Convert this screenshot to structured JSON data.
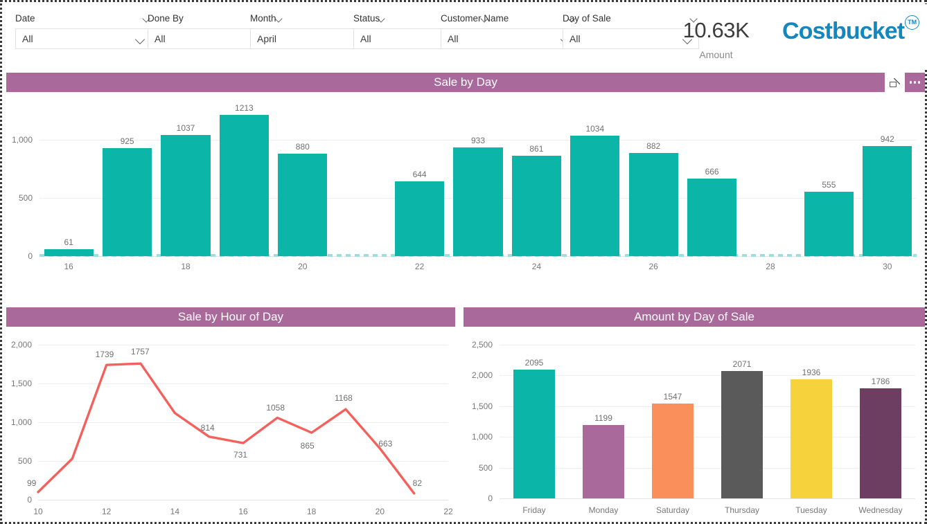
{
  "header": {
    "slicers": [
      {
        "label": "Date",
        "value": "All"
      },
      {
        "label": "Done By",
        "value": "All"
      },
      {
        "label": "Month",
        "value": "April"
      },
      {
        "label": "Status",
        "value": "All"
      },
      {
        "label": "Customer Name",
        "value": "All"
      },
      {
        "label": "Day of Sale",
        "value": "All"
      }
    ],
    "kpi": {
      "value": "10.63K",
      "label": "Amount"
    },
    "logo": {
      "text": "Costbucket",
      "tm": "TM"
    }
  },
  "cards": {
    "sale_by_day": {
      "title": "Sale by Day",
      "focus_icon": "focus-mode-icon",
      "more_icon": "more-options-icon"
    },
    "sale_by_hour": {
      "title": "Sale by Hour of Day"
    },
    "amount_by_day_of_sale": {
      "title": "Amount by Day of Sale"
    }
  },
  "colors": {
    "title_bar": "#a9699b",
    "teal": "#0bb5a8",
    "line_red": "#f4615c",
    "brand_blue": "#1287c0",
    "gridline": "#eeeeee"
  },
  "chart_data": [
    {
      "type": "bar",
      "title": "Sale by Day",
      "xlabel": "",
      "ylabel": "",
      "ylim": [
        0,
        1300
      ],
      "yticks": [
        0,
        500,
        1000
      ],
      "ytick_labels": [
        "0",
        "500",
        "1,000"
      ],
      "grid": true,
      "legend": "none",
      "bar_color": "#0bb5a8",
      "categories": [
        16,
        17,
        18,
        19,
        20,
        21,
        22,
        23,
        24,
        25,
        26,
        27,
        28,
        29,
        30
      ],
      "xtick_labels": [
        "16",
        "18",
        "20",
        "22",
        "24",
        "26",
        "28",
        "30"
      ],
      "values": [
        61,
        925,
        1037,
        1213,
        880,
        null,
        644,
        933,
        861,
        1034,
        882,
        666,
        null,
        555,
        942
      ],
      "data_labels": [
        "61",
        "925",
        "1037",
        "1213",
        "880",
        "",
        "644",
        "933",
        "861",
        "1034",
        "882",
        "666",
        "",
        "555",
        "942"
      ]
    },
    {
      "type": "line",
      "title": "Sale by Hour of Day",
      "xlabel": "",
      "ylabel": "",
      "ylim": [
        0,
        2000
      ],
      "yticks": [
        0,
        500,
        1000,
        1500,
        2000
      ],
      "ytick_labels": [
        "0",
        "500",
        "1,000",
        "1,500",
        "2,000"
      ],
      "grid": true,
      "legend": "none",
      "line_color": "#f4615c",
      "x": [
        10,
        11,
        12,
        13,
        14,
        15,
        16,
        17,
        18,
        19,
        20,
        21
      ],
      "xtick_labels": [
        "10",
        "12",
        "14",
        "16",
        "18",
        "20",
        "22"
      ],
      "values": [
        99,
        530,
        1739,
        1757,
        1120,
        814,
        731,
        1058,
        865,
        1168,
        663,
        82
      ],
      "data_labels": [
        "99",
        "",
        "1739",
        "1757",
        "",
        "814",
        "731",
        "1058",
        "865",
        "1168",
        "663",
        "82"
      ]
    },
    {
      "type": "bar",
      "title": "Amount by Day of Sale",
      "xlabel": "",
      "ylabel": "",
      "ylim": [
        0,
        2500
      ],
      "yticks": [
        0,
        500,
        1000,
        1500,
        2000,
        2500
      ],
      "ytick_labels": [
        "0",
        "500",
        "1,000",
        "1,500",
        "2,000",
        "2,500"
      ],
      "grid": true,
      "legend": "none",
      "categories": [
        "Friday",
        "Monday",
        "Saturday",
        "Thursday",
        "Tuesday",
        "Wednesday"
      ],
      "values": [
        2095,
        1199,
        1547,
        2071,
        1936,
        1786
      ],
      "data_labels": [
        "2095",
        "1199",
        "1547",
        "2071",
        "1936",
        "1786"
      ],
      "bar_colors": [
        "#0bb5a8",
        "#a9699b",
        "#fb8f5c",
        "#5a5a5a",
        "#f6d33c",
        "#6d3e61"
      ]
    }
  ]
}
